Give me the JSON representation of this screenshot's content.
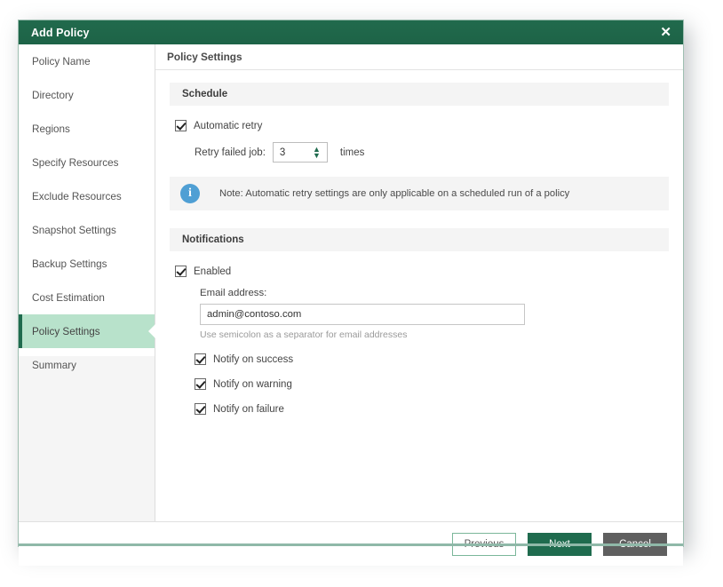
{
  "dialog": {
    "title": "Add Policy",
    "close_icon": "close-icon",
    "close_glyph": "✕"
  },
  "sidebar": {
    "items": [
      {
        "label": "Policy Name",
        "state": "done"
      },
      {
        "label": "Directory",
        "state": "done"
      },
      {
        "label": "Regions",
        "state": "done"
      },
      {
        "label": "Specify Resources",
        "state": "done"
      },
      {
        "label": "Exclude Resources",
        "state": "done"
      },
      {
        "label": "Snapshot Settings",
        "state": "done"
      },
      {
        "label": "Backup Settings",
        "state": "done"
      },
      {
        "label": "Cost Estimation",
        "state": "done"
      },
      {
        "label": "Policy Settings",
        "state": "active"
      },
      {
        "label": "Summary",
        "state": "pending"
      }
    ]
  },
  "content": {
    "header": "Policy Settings",
    "schedule": {
      "section_title": "Schedule",
      "automatic_retry_label": "Automatic retry",
      "automatic_retry_checked": true,
      "retry_label": "Retry failed job:",
      "retry_value": "3",
      "times_label": "times",
      "note_icon": "info-icon",
      "note_text": "Note: Automatic retry settings are only applicable on a scheduled run of a policy"
    },
    "notifications": {
      "section_title": "Notifications",
      "enabled_label": "Enabled",
      "enabled_checked": true,
      "email_label": "Email address:",
      "email_value": "admin@contoso.com",
      "email_placeholder": "",
      "email_hint": "Use semicolon as a separator for email addresses",
      "options": [
        {
          "label": "Notify on success",
          "checked": true
        },
        {
          "label": "Notify on warning",
          "checked": true
        },
        {
          "label": "Notify on failure",
          "checked": true
        }
      ]
    }
  },
  "footer": {
    "previous_label": "Previous",
    "next_label": "Next",
    "cancel_label": "Cancel"
  },
  "colors": {
    "brand_green": "#1f6b4e",
    "active_nav": "#b8e2cb",
    "link_blue": "#3c8dbc",
    "info_blue": "#4f9fd4",
    "cancel_grey": "#5f5f5f"
  }
}
